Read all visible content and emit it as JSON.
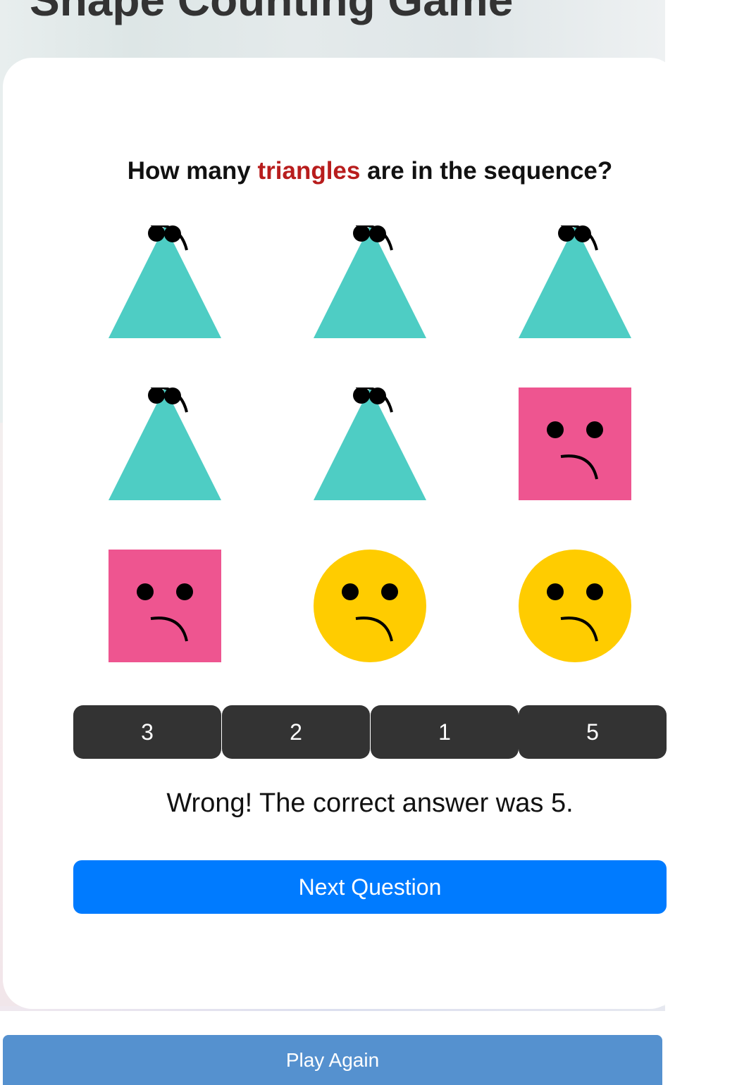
{
  "game": {
    "title": "Shape Counting Game",
    "question_prefix": "How many",
    "question_target": "triangles",
    "question_suffix": "are in the sequence?",
    "shapes": [
      {
        "type": "triangle",
        "color": "#4ecdc4",
        "face": "sad"
      },
      {
        "type": "triangle",
        "color": "#4ecdc4",
        "face": "sad"
      },
      {
        "type": "triangle",
        "color": "#4ecdc4",
        "face": "sad"
      },
      {
        "type": "triangle",
        "color": "#4ecdc4",
        "face": "sad"
      },
      {
        "type": "triangle",
        "color": "#4ecdc4",
        "face": "sad"
      },
      {
        "type": "square",
        "color": "#ee5590",
        "face": "sad"
      },
      {
        "type": "square",
        "color": "#ee5590",
        "face": "sad"
      },
      {
        "type": "circle",
        "color": "#ffcc00",
        "face": "sad"
      },
      {
        "type": "circle",
        "color": "#ffcc00",
        "face": "sad"
      }
    ],
    "options": [
      "3",
      "2",
      "1",
      "5"
    ],
    "feedback": "Wrong! The correct answer was 5.",
    "next_label": "Next Question",
    "play_again_label": "Play Again"
  },
  "colors": {
    "target_highlight": "#b81d1d",
    "option_button": "#333333",
    "next_button": "#007bff",
    "play_again_button": "#5591cf"
  }
}
